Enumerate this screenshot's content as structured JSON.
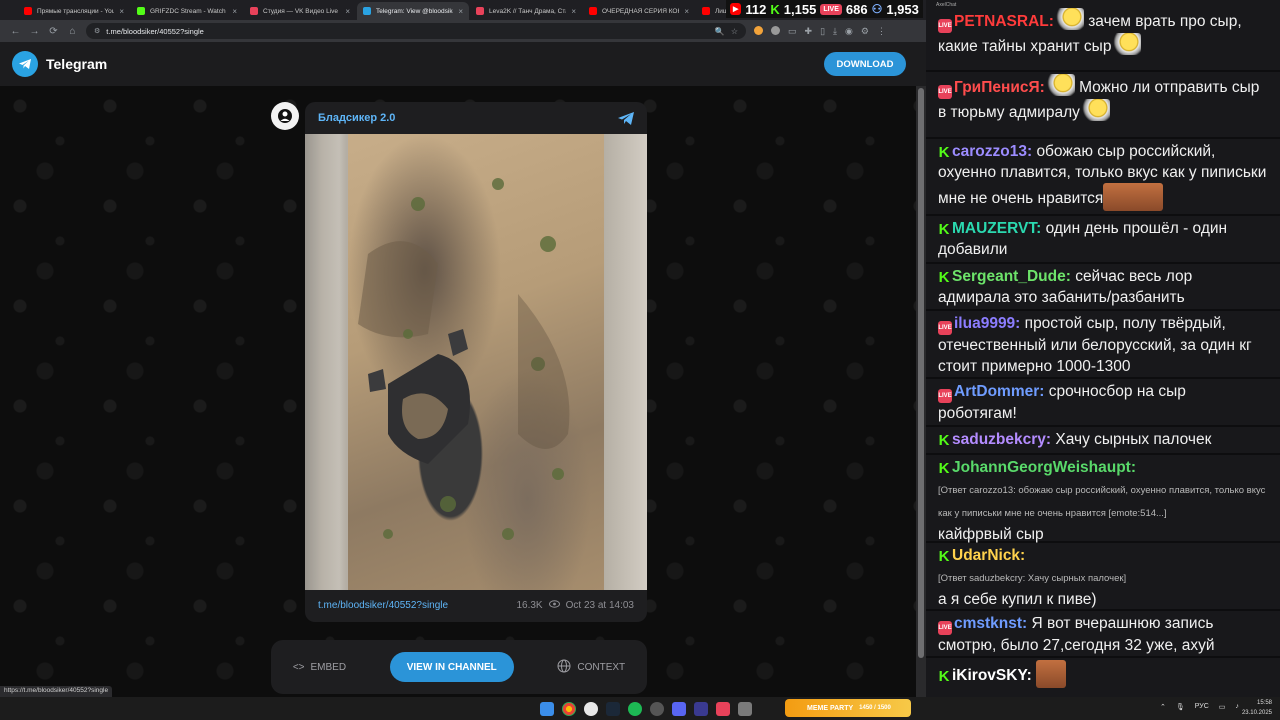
{
  "browser": {
    "tabs": [
      {
        "label": "Прямые трансляции - YouT",
        "color": "#ff0000",
        "active": false
      },
      {
        "label": "GRIFZDC Stream - Watch Liv",
        "color": "#53fc18",
        "active": false
      },
      {
        "label": "Студия — VK Видео Live",
        "color": "#e8425a",
        "active": false
      },
      {
        "label": "Telegram: View @bloodsiker",
        "color": "#2aa3e3",
        "active": true
      },
      {
        "label": "Leva2K // Танч Драма, Стакс",
        "color": "#e8425a",
        "active": false
      },
      {
        "label": "ОЧЕРЕДНАЯ СЕРИЯ КОНФЛ",
        "color": "#ff0000",
        "active": false
      },
      {
        "label": "Лиш",
        "color": "#ff0000",
        "active": false
      }
    ],
    "url": "t.me/bloodsiker/40552?single",
    "status_url": "https://t.me/bloodsiker/40552?single"
  },
  "telegram": {
    "brand": "Telegram",
    "download_label": "DOWNLOAD",
    "post": {
      "author": "Бладсикер 2.0",
      "link": "t.me/bloodsiker/40552?single",
      "views": "16.3K",
      "date": "Oct 23 at 14:03"
    },
    "actions": {
      "embed": "EMBED",
      "view_in_channel": "VIEW IN CHANNEL",
      "context": "CONTEXT"
    }
  },
  "stream_stats": {
    "youtube": "112",
    "kick": "1,155",
    "vk_badge": "LIVE",
    "vk": "686",
    "total": "1,953",
    "window_title": "AxelChat"
  },
  "chat": [
    {
      "src": "vk",
      "nick": "PETNASRAL:",
      "nick_color": "#ff3b3b",
      "text": "зачем врать про сыр, какие тайны хранит сыр",
      "emotes": [
        "cheese-emote",
        "cheese-emote"
      ]
    },
    {
      "src": "vk",
      "nick": "ГриПенисЯ:",
      "nick_color": "#ff4d4d",
      "text": "Можно ли отправить сыр в тюрьму адмиралу",
      "emotes": [
        "cheese-emote",
        "cheese-emote"
      ]
    },
    {
      "src": "kick",
      "nick": "carozzo13:",
      "nick_color": "#9c8cff",
      "text": "обожаю сыр российский, охуенно плавится, только вкус как у пиписьки мне не очень нравится",
      "emotes": [
        "face-emote"
      ]
    },
    {
      "src": "kick",
      "nick": "MAUZERVT:",
      "nick_color": "#2bd9b0",
      "text": "один день прошёл - один добавили"
    },
    {
      "src": "kick",
      "nick": "Sergeant_Dude:",
      "nick_color": "#6de36a",
      "text": "сейчас весь лор адмирала это забанить/разбанить"
    },
    {
      "src": "vk",
      "nick": "ilua9999:",
      "nick_color": "#8c7dff",
      "text": "простой сыр, полу твёрдый, отечественный или белорусский, за один кг стоит примерно 1000-1300"
    },
    {
      "src": "vk",
      "nick": "ArtDommer:",
      "nick_color": "#6f9cff",
      "text": "срочносбор на сыр роботягам!"
    },
    {
      "src": "kick",
      "nick": "saduzbekcry:",
      "nick_color": "#b48cff",
      "text": "Хачу сырных палочек"
    },
    {
      "src": "kick",
      "nick": "JohannGeorgWeishaupt:",
      "nick_color": "#59d96a",
      "reply": "[Ответ carozzo13: обожаю сыр российский, охуенно плавится, только вкус как у пиписьки мне не очень нравится [emote:514...]",
      "text": "кайфрвый сыр"
    },
    {
      "src": "kick",
      "nick": "UdarNick:",
      "nick_color": "#ffd24d",
      "reply": "[Ответ saduzbekcry: Хачу сырных палочек]",
      "text": "а я себе купил к пиве)"
    },
    {
      "src": "vk",
      "nick": "cmstknst:",
      "nick_color": "#6f9cff",
      "text": "Я вот вчерашнюю запись смотрю, было 27,сегодня 32 уже, ахуй"
    },
    {
      "src": "kick",
      "nick": "iKirovSKY:",
      "nick_color": "#ffffff",
      "text": "",
      "emotes": [
        "face-emote"
      ]
    }
  ],
  "taskbar": {
    "meme_party": "MEME PARTY",
    "meme_count": "1450 / 1500",
    "lang": "РУС",
    "time": "15:58",
    "date": "23.10.2025"
  }
}
